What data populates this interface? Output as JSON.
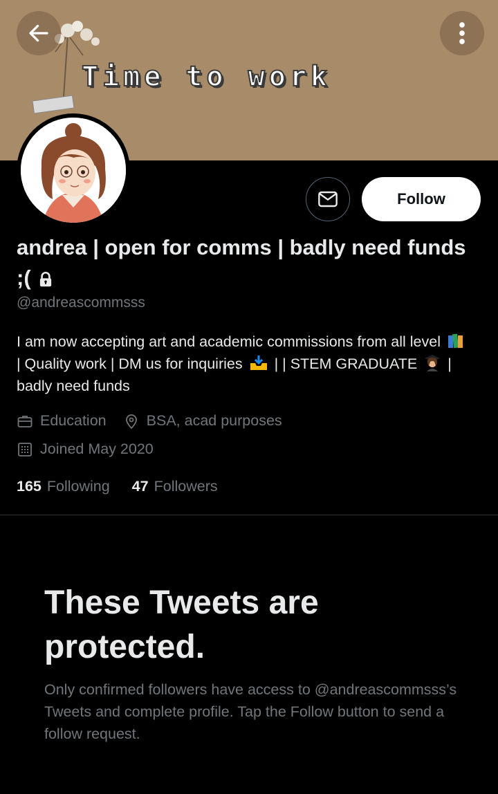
{
  "header": {
    "banner_title": "Time to work",
    "banner_color": "#a88b68",
    "back_icon": "arrow-left-icon",
    "more_icon": "vertical-dots-icon"
  },
  "actions": {
    "message_icon": "envelope-icon",
    "follow_label": "Follow"
  },
  "profile": {
    "name": "andrea | open for comms | badly need funds ;(",
    "protected_icon": "lock-icon",
    "handle": "@andreascommsss",
    "bio": {
      "part1": "I am now accepting art and academic commissions from all level",
      "part2": "| Quality work | DM us for inquiries",
      "part3": "|  | STEM GRADUATE",
      "part4": "| badly need funds"
    },
    "category": "Education",
    "location": "BSA, acad purposes",
    "joined": "Joined May 2020"
  },
  "stats": {
    "following_count": "165",
    "following_label": "Following",
    "followers_count": "47",
    "followers_label": "Followers"
  },
  "protected_notice": {
    "title": "These Tweets are protected.",
    "text": "Only confirmed followers have access to @andreascommsss’s Tweets and complete profile. Tap the Follow button to send a follow request."
  }
}
